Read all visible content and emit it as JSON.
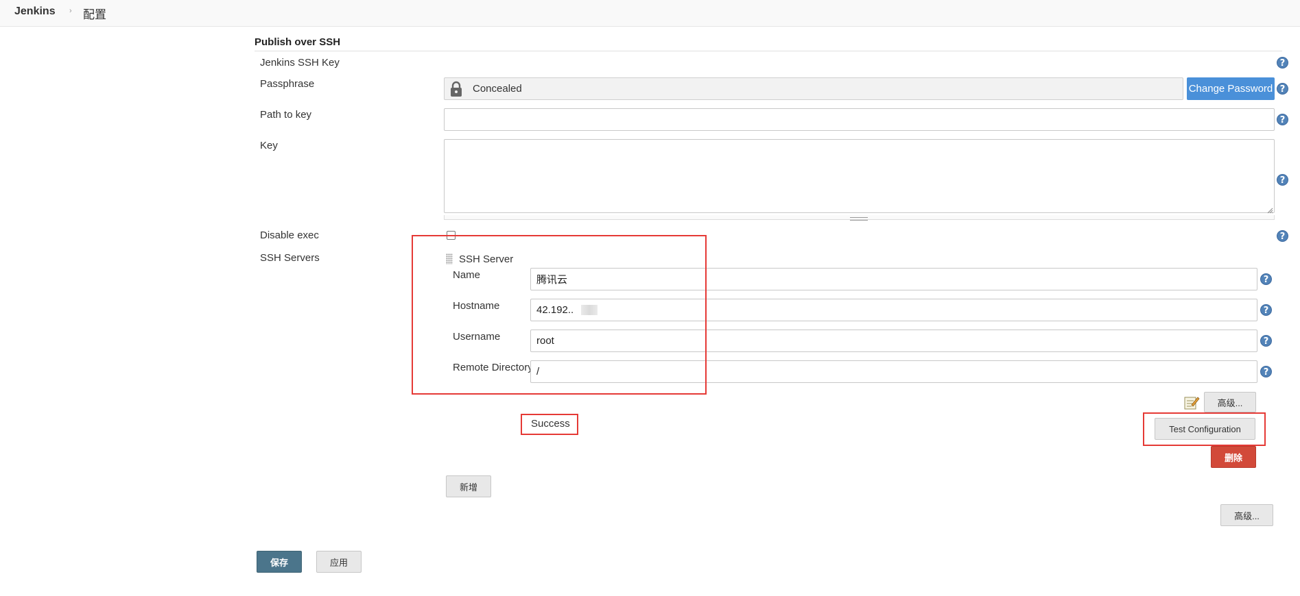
{
  "breadcrumb": {
    "root": "Jenkins",
    "separator": "›",
    "current": "配置"
  },
  "section": {
    "title": "Publish over SSH"
  },
  "fields": {
    "ssh_key_label": "Jenkins SSH Key",
    "passphrase_label": "Passphrase",
    "passphrase_value": "Concealed",
    "change_password": "Change Password",
    "path_to_key_label": "Path to key",
    "path_to_key_value": "",
    "key_label": "Key",
    "key_value": "",
    "disable_exec_label": "Disable exec",
    "disable_exec_checked": false,
    "ssh_servers_label": "SSH Servers"
  },
  "server": {
    "heading": "SSH Server",
    "name_label": "Name",
    "name_value": "腾讯云",
    "hostname_label": "Hostname",
    "hostname_value": "42.192..",
    "username_label": "Username",
    "username_value": "root",
    "remote_dir_label": "Remote Directory",
    "remote_dir_value": "/",
    "advanced": "高级...",
    "status": "Success",
    "test_config": "Test Configuration",
    "delete": "删除"
  },
  "actions": {
    "add": "新增",
    "advanced": "高级...",
    "save": "保存",
    "apply": "应用"
  },
  "help_glyph": "?",
  "colors": {
    "accent_blue": "#4a90d9",
    "help_icon": "#5283b8",
    "delete_red": "#d24939",
    "save_blue": "#4b758b",
    "highlight_red": "#e53935"
  }
}
